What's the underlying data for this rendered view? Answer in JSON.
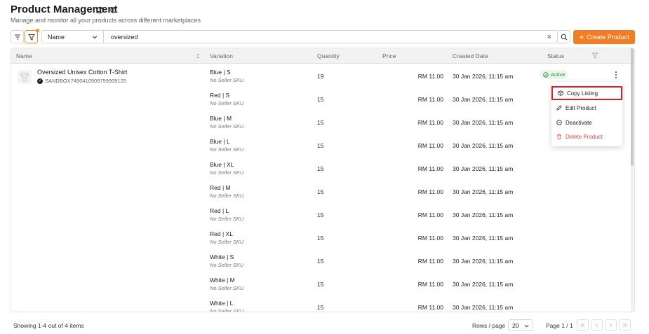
{
  "header": {
    "title": "Product Management",
    "subtitle": "Manage and monitor all your products across different marketplaces"
  },
  "toolbar": {
    "field_select": "Name",
    "search_value": "oversized",
    "clear_symbol": "×",
    "create_label": "Create Product"
  },
  "table": {
    "columns": [
      "Name",
      "Variation",
      "Quantity",
      "Price",
      "Created Date",
      "Status"
    ],
    "product": {
      "name": "Oversized Unisex Cotton T-Shirt",
      "sku": "SANDBOX7490410909799909125",
      "status": "Active"
    },
    "rows": [
      {
        "variation": "Blue | S",
        "sku": "No Seller SKU",
        "qty": "19",
        "price": "RM 11.00",
        "date": "30 Jan 2026, 11:15 am"
      },
      {
        "variation": "Red | S",
        "sku": "No Seller SKU",
        "qty": "15",
        "price": "RM 11.00",
        "date": "30 Jan 2026, 11:15 am"
      },
      {
        "variation": "Blue | M",
        "sku": "No Seller SKU",
        "qty": "15",
        "price": "RM 11.00",
        "date": "30 Jan 2026, 11:15 am"
      },
      {
        "variation": "Blue | L",
        "sku": "No Seller SKU",
        "qty": "15",
        "price": "RM 11.00",
        "date": "30 Jan 2026, 11:15 am"
      },
      {
        "variation": "Blue | XL",
        "sku": "No Seller SKU",
        "qty": "15",
        "price": "RM 11.00",
        "date": "30 Jan 2026, 11:15 am"
      },
      {
        "variation": "Red | M",
        "sku": "No Seller SKU",
        "qty": "15",
        "price": "RM 11.00",
        "date": "30 Jan 2026, 11:15 am"
      },
      {
        "variation": "Red | L",
        "sku": "No Seller SKU",
        "qty": "15",
        "price": "RM 11.00",
        "date": "30 Jan 2026, 11:15 am"
      },
      {
        "variation": "Red | XL",
        "sku": "No Seller SKU",
        "qty": "15",
        "price": "RM 11.00",
        "date": "30 Jan 2026, 11:15 am"
      },
      {
        "variation": "White | S",
        "sku": "No Seller SKU",
        "qty": "15",
        "price": "RM 11.00",
        "date": "30 Jan 2026, 11:15 am"
      },
      {
        "variation": "White | M",
        "sku": "No Seller SKU",
        "qty": "15",
        "price": "RM 11.00",
        "date": "30 Jan 2026, 11:15 am"
      },
      {
        "variation": "White | L",
        "sku": "No Seller SKU",
        "qty": "15",
        "price": "RM 11.00",
        "date": "30 Jan 2026, 11:15 am"
      }
    ]
  },
  "action_menu": {
    "items": [
      {
        "label": "Copy Listing",
        "icon": "copy-icon"
      },
      {
        "label": "Edit Product",
        "icon": "edit-icon"
      },
      {
        "label": "Deactivate",
        "icon": "deactivate-icon"
      },
      {
        "label": "Delete Product",
        "icon": "trash-icon"
      }
    ]
  },
  "footer": {
    "showing": "Showing 1-4 out of 4 items",
    "rows_per_page_label": "Rows / page",
    "rows_per_page": "20",
    "page": "Page 1 / 1"
  },
  "colors": {
    "accent": "#f27d22",
    "active_badge": "#2e8b3e",
    "danger": "#e04545",
    "highlight": "#e01c24"
  }
}
